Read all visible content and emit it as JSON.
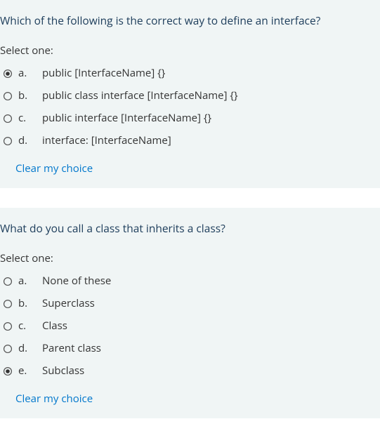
{
  "questions": [
    {
      "prompt": "Which of the following is the correct way to define an interface?",
      "select_label": "Select one:",
      "options": [
        {
          "letter": "a.",
          "text": "public [InterfaceName] {}",
          "selected": true
        },
        {
          "letter": "b.",
          "text": "public class interface [InterfaceName] {}",
          "selected": false
        },
        {
          "letter": "c.",
          "text": "public interface [InterfaceName] {}",
          "selected": false
        },
        {
          "letter": "d.",
          "text": "interface: [InterfaceName]",
          "selected": false
        }
      ],
      "clear_label": "Clear my choice"
    },
    {
      "prompt": "What do you call a class that inherits a class?",
      "select_label": "Select one:",
      "options": [
        {
          "letter": "a.",
          "text": "None of these",
          "selected": false
        },
        {
          "letter": "b.",
          "text": "Superclass",
          "selected": false
        },
        {
          "letter": "c.",
          "text": "Class",
          "selected": false
        },
        {
          "letter": "d.",
          "text": "Parent class",
          "selected": false
        },
        {
          "letter": "e.",
          "text": "Subclass",
          "selected": true
        }
      ],
      "clear_label": "Clear my choice"
    }
  ]
}
